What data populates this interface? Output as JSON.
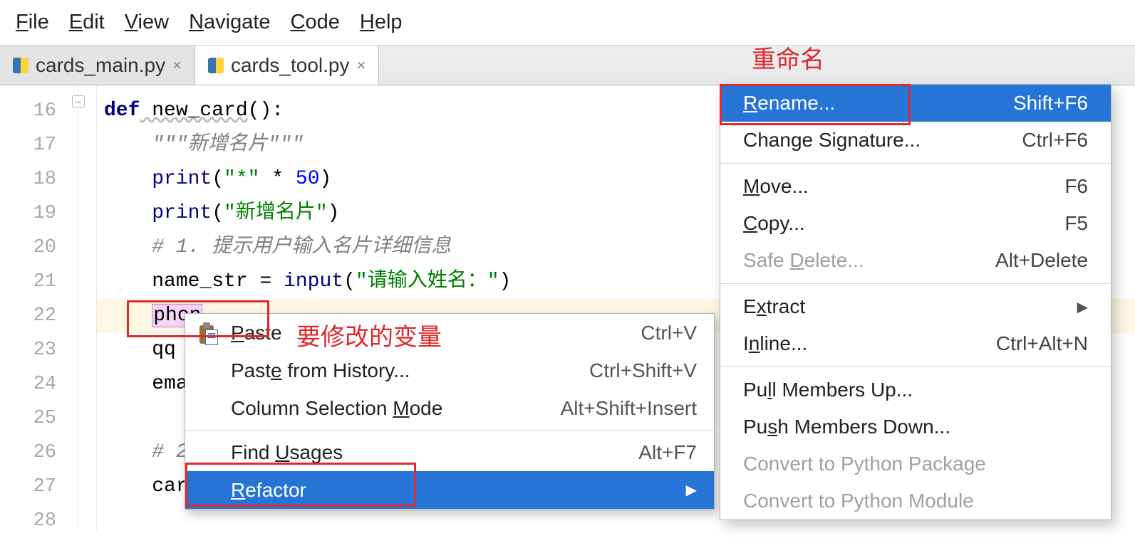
{
  "menubar": {
    "file": "File",
    "edit": "Edit",
    "view": "View",
    "navigate": "Navigate",
    "code": "Code",
    "help": "Help"
  },
  "tabs": [
    {
      "label": "cards_main.py",
      "active": false
    },
    {
      "label": "cards_tool.py",
      "active": true
    }
  ],
  "gutter_lines": [
    "16",
    "17",
    "18",
    "19",
    "20",
    "21",
    "22",
    "23",
    "24",
    "25",
    "26",
    "27",
    "28"
  ],
  "code": {
    "l16_kw": "def",
    "l16_fn": " new_card",
    "l16_rest": "():",
    "l17_doc": "\"\"\"新增名片\"\"\"",
    "l18_a": "print",
    "l18_b": "(",
    "l18_c": "\"*\"",
    "l18_d": " * ",
    "l18_e": "50",
    "l18_f": ")",
    "l19_a": "print",
    "l19_b": "(",
    "l19_c": "\"新增名片\"",
    "l19_d": ")",
    "l20": "# 1. 提示用户输入名片详细信息",
    "l21_a": "name_str = ",
    "l21_b": "input",
    "l21_c": "(",
    "l21_d": "\"请输入姓名：\"",
    "l21_e": ")",
    "l22_token": "phon",
    "l23": "qq =",
    "l24": "emai",
    "l26": "# 2",
    "l27": "card"
  },
  "context_menu": [
    {
      "label": "Paste",
      "mn": 0,
      "shortcut": "Ctrl+V",
      "icon": "paste"
    },
    {
      "label": "Paste from History...",
      "mn": 4,
      "shortcut": "Ctrl+Shift+V"
    },
    {
      "label": "Column Selection Mode",
      "mn": 17,
      "shortcut": "Alt+Shift+Insert"
    },
    {
      "sep": true
    },
    {
      "label": "Find Usages",
      "mn": 5,
      "shortcut": "Alt+F7"
    },
    {
      "label": "Refactor",
      "mn": 0,
      "submenu": true,
      "selected": true
    }
  ],
  "submenu": [
    {
      "label": "Rename...",
      "mn": 0,
      "shortcut": "Shift+F6",
      "selected": true
    },
    {
      "label": "Change Signature...",
      "shortcut": "Ctrl+F6"
    },
    {
      "sep": true
    },
    {
      "label": "Move...",
      "mn": 0,
      "shortcut": "F6"
    },
    {
      "label": "Copy...",
      "mn": 0,
      "shortcut": "F5"
    },
    {
      "label": "Safe Delete...",
      "mn": 5,
      "shortcut": "Alt+Delete",
      "disabled": true
    },
    {
      "sep": true
    },
    {
      "label": "Extract",
      "mn": 1,
      "submenu": true
    },
    {
      "label": "Inline...",
      "mn": 1,
      "shortcut": "Ctrl+Alt+N"
    },
    {
      "sep": true
    },
    {
      "label": "Pull Members Up...",
      "mn": 2
    },
    {
      "label": "Push Members Down...",
      "mn": 2
    },
    {
      "label": "Convert to Python Package",
      "disabled": true
    },
    {
      "label": "Convert to Python Module",
      "disabled": true
    }
  ],
  "annotations": {
    "rename_label": "重命名",
    "variable_label": "要修改的变量"
  }
}
